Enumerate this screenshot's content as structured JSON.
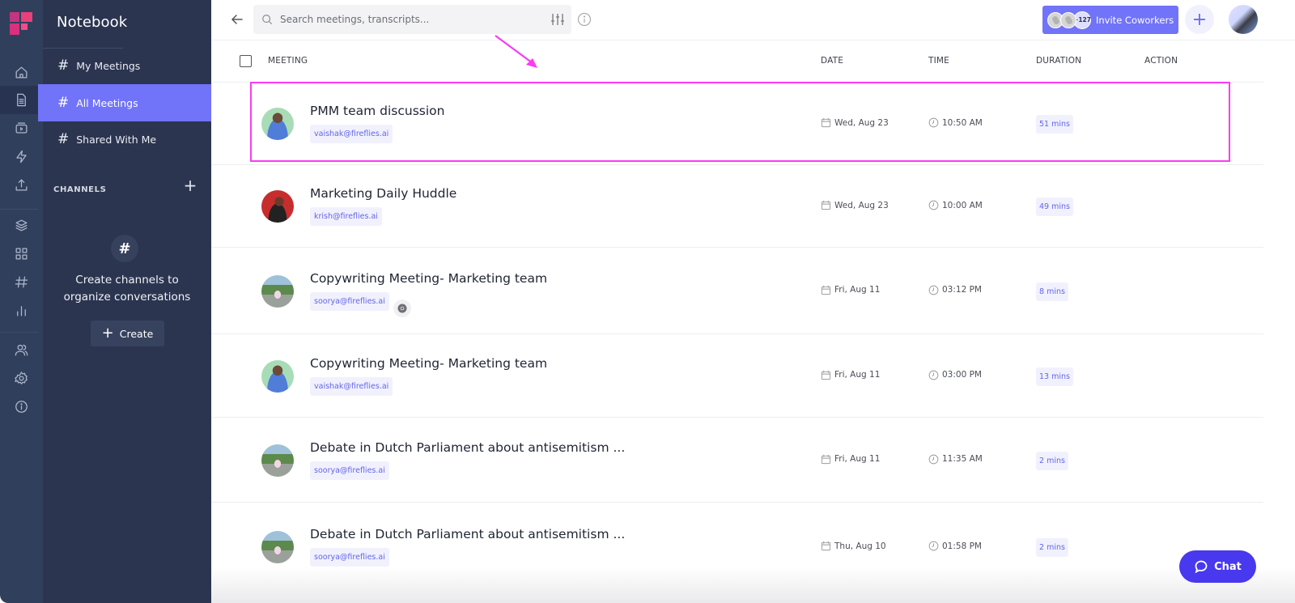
{
  "app": {
    "brand_colors": {
      "accent": "#7173f8",
      "highlight": "#fa3cf3",
      "chat": "#4838ee",
      "sidebar_bg": "#2b3550",
      "rail_bg": "#303f5c"
    }
  },
  "rail": {
    "icons": [
      {
        "name": "home-icon",
        "active": false
      },
      {
        "name": "notebook-icon",
        "active": true
      },
      {
        "name": "meeting-recorder-icon",
        "active": false
      },
      {
        "name": "integrations-bolt-icon",
        "active": false
      },
      {
        "name": "upload-icon",
        "active": false
      },
      {
        "name": "layers-icon",
        "active": false
      },
      {
        "name": "apps-grid-icon",
        "active": false
      },
      {
        "name": "channels-hash-icon",
        "active": false
      },
      {
        "name": "analytics-icon",
        "active": false
      },
      {
        "name": "team-icon",
        "active": false
      },
      {
        "name": "settings-icon",
        "active": false
      },
      {
        "name": "info-icon",
        "active": false
      }
    ]
  },
  "sidebar": {
    "title": "Notebook",
    "items": [
      {
        "label": "My Meetings",
        "icon": "#",
        "active": false
      },
      {
        "label": "All Meetings",
        "icon": "#",
        "active": true
      },
      {
        "label": "Shared With Me",
        "icon": "#",
        "active": false
      }
    ],
    "channels_label": "CHANNELS",
    "channels_add": "+",
    "empty_icon": "#",
    "empty_text_line1": "Create channels to",
    "empty_text_line2": "organize conversations",
    "create_button": "Create",
    "create_plus": "+"
  },
  "topbar": {
    "search_placeholder": "Search meetings, transcripts...",
    "search_value": "",
    "invite_count": "+127",
    "invite_label": "Invite Coworkers",
    "add_label": "+"
  },
  "table": {
    "headers": {
      "meeting": "MEETING",
      "date": "DATE",
      "time": "TIME",
      "duration": "DURATION",
      "action": "ACTION"
    },
    "rows": [
      {
        "title": "PMM team discussion",
        "email": "vaishak@fireflies.ai",
        "date": "Wed, Aug 23",
        "time": "10:50 AM",
        "duration": "51 mins",
        "avatar": "vaishak",
        "source_icon": null,
        "highlighted": true
      },
      {
        "title": "Marketing Daily Huddle",
        "email": "krish@fireflies.ai",
        "date": "Wed, Aug 23",
        "time": "10:00 AM",
        "duration": "49 mins",
        "avatar": "krish",
        "source_icon": null,
        "highlighted": false
      },
      {
        "title": "Copywriting Meeting- Marketing team",
        "email": "soorya@fireflies.ai",
        "date": "Fri, Aug 11",
        "time": "03:12 PM",
        "duration": "8 mins",
        "avatar": "soorya",
        "source_icon": "chrome-icon",
        "highlighted": false
      },
      {
        "title": "Copywriting Meeting- Marketing team",
        "email": "vaishak@fireflies.ai",
        "date": "Fri, Aug 11",
        "time": "03:00 PM",
        "duration": "13 mins",
        "avatar": "vaishak",
        "source_icon": null,
        "highlighted": false
      },
      {
        "title": "Debate in Dutch Parliament about antisemitism ...",
        "email": "soorya@fireflies.ai",
        "date": "Fri, Aug 11",
        "time": "11:35 AM",
        "duration": "2 mins",
        "avatar": "soorya",
        "source_icon": null,
        "highlighted": false
      },
      {
        "title": "Debate in Dutch Parliament about antisemitism ...",
        "email": "soorya@fireflies.ai",
        "date": "Thu, Aug 10",
        "time": "01:58 PM",
        "duration": "2 mins",
        "avatar": "soorya",
        "source_icon": null,
        "highlighted": false
      }
    ]
  },
  "chat": {
    "label": "Chat"
  }
}
